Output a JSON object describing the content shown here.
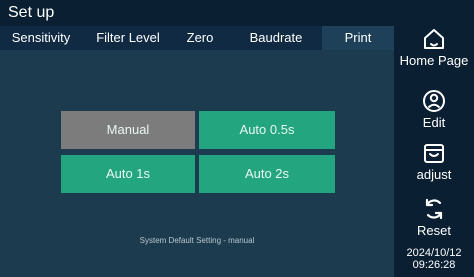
{
  "header": {
    "title": "Set up"
  },
  "tabs": [
    {
      "label": "Sensitivity"
    },
    {
      "label": "Filter Level"
    },
    {
      "label": "Zero"
    },
    {
      "label": "Baudrate"
    },
    {
      "label": "Print",
      "active": true
    }
  ],
  "print_options": {
    "manual": "Manual",
    "auto_0_5s": "Auto 0.5s",
    "auto_1s": "Auto 1s",
    "auto_2s": "Auto 2s",
    "selected": "Manual"
  },
  "status": {
    "default_setting": "System Default Setting - manual"
  },
  "sidebar": {
    "home_label": "Home Page",
    "edit_label": "Edit",
    "adjust_label": "adjust",
    "reset_label": "Reset"
  },
  "datetime": {
    "date": "2024/10/12",
    "time": "09:26:28"
  },
  "colors": {
    "background": "#0b1f33",
    "panel": "#1d3b4f",
    "active_tab": "#1e4058",
    "option_green": "#23a680",
    "option_selected_gray": "#7c7c7c"
  },
  "icons": {
    "home": "home-icon",
    "edit": "user-circle-icon",
    "adjust": "box-icon",
    "reset": "refresh-icon"
  }
}
